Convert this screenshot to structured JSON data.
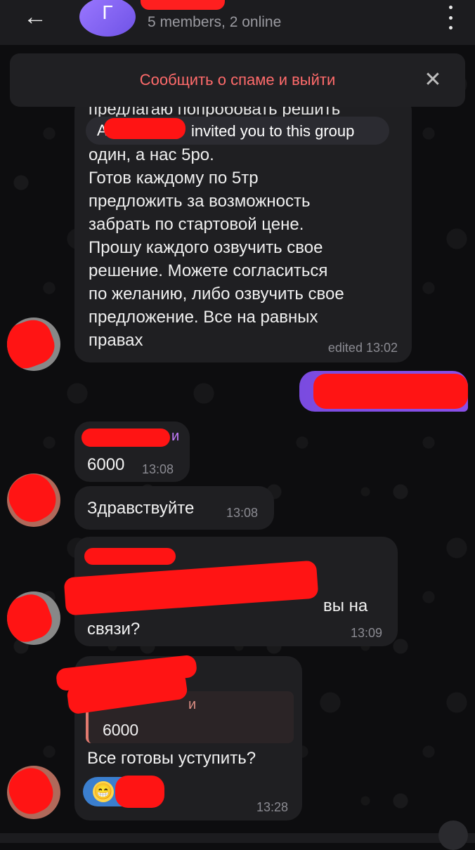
{
  "header": {
    "avatar_letter": "Г",
    "subtitle": "5 members, 2 online"
  },
  "spam_bar": {
    "label": "Сообщить о спаме и выйти"
  },
  "messages": [
    {
      "partial_top_line": "предлагаю попробовать решить",
      "invite": {
        "prefix": "А",
        "text": "invited you to this group"
      },
      "lines": [
        "один, а нас 5ро.",
        "Готов каждому по 5тр",
        "предложить за возможность",
        "забрать по стартовой цене.",
        "Прошу каждого озвучить свое",
        "решение. Можете согласиться",
        "по желанию, либо озвучить свое",
        "предложение. Все на равных",
        "правах"
      ],
      "time": "edited 13:02"
    },
    {
      "name_tail": "и",
      "text": "6000",
      "time": "13:08"
    },
    {
      "text": "Здравствуйте",
      "time": "13:08"
    },
    {
      "text_tail": "вы на",
      "text_line2": "связи?",
      "time": "13:09"
    },
    {
      "quote_name_tail": "и",
      "quote_text": "6000",
      "text": "Все готовы уступить?",
      "reaction_emoji": "😁",
      "time": "13:28"
    }
  ]
}
